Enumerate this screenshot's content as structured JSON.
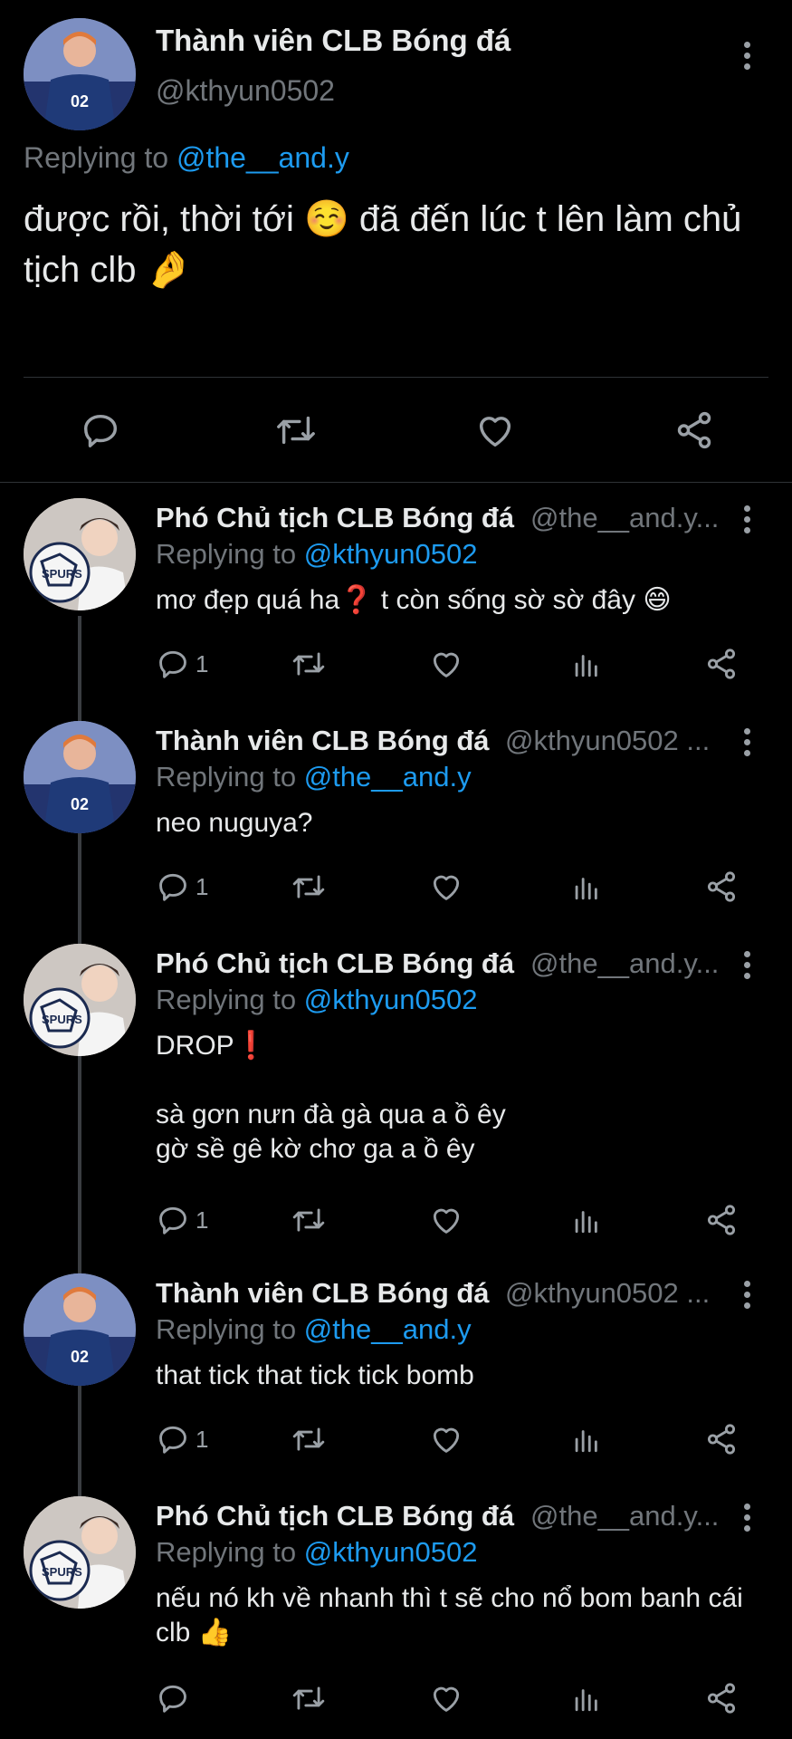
{
  "main_tweet": {
    "display_name": "Thành viên CLB Bóng đá",
    "handle": "@kthyun0502",
    "replying_prefix": "Replying to",
    "replying_handle": "@the__and.y",
    "text": "được rồi, thời tới ☺️ đã đến lúc t lên làm chủ tịch clb 🤌"
  },
  "replies": [
    {
      "display_name": "Phó Chủ tịch CLB Bóng đá",
      "handle": "@the__and.y...",
      "replying_prefix": "Replying to",
      "replying_handle": "@kthyun0502",
      "text": "mơ đẹp quá ha❓ t còn sống sờ sờ đây 😄",
      "reply_count": "1"
    },
    {
      "display_name": "Thành viên CLB Bóng đá",
      "handle": "@kthyun0502 ...",
      "replying_prefix": "Replying to",
      "replying_handle": "@the__and.y",
      "text": "neo nuguya?",
      "reply_count": "1"
    },
    {
      "display_name": "Phó Chủ tịch CLB Bóng đá",
      "handle": "@the__and.y...",
      "replying_prefix": "Replying to",
      "replying_handle": "@kthyun0502",
      "text": "DROP❗\n\nsà gơn nưn đà gà qua a ồ êy\ngờ sề gê kờ chơ ga a ồ êy",
      "reply_count": "1"
    },
    {
      "display_name": "Thành viên CLB Bóng đá",
      "handle": "@kthyun0502 ...",
      "replying_prefix": "Replying to",
      "replying_handle": "@the__and.y",
      "text": "that tick that tick tick bomb",
      "reply_count": "1"
    },
    {
      "display_name": "Phó Chủ tịch CLB Bóng đá",
      "handle": "@the__and.y...",
      "replying_prefix": "Replying to",
      "replying_handle": "@kthyun0502",
      "text": "nếu nó kh về nhanh thì t sẽ cho nổ bom banh cái clb 👍",
      "reply_count": ""
    }
  ],
  "avatars": {
    "member": {
      "jersey_number": "02"
    },
    "vice_president": {
      "ball_text": "SPURS"
    }
  },
  "colors": {
    "background": "#000000",
    "link": "#1d9bf0",
    "muted": "#71767b",
    "text": "#e7e9ea"
  },
  "icons": [
    "reply-icon",
    "retweet-icon",
    "like-icon",
    "share-icon",
    "views-icon",
    "more-icon"
  ]
}
